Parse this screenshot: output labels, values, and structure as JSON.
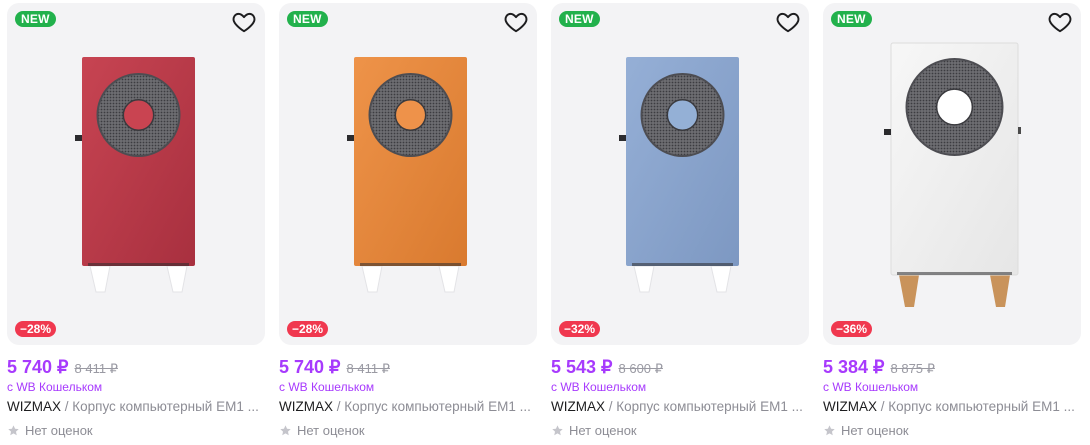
{
  "colors": {
    "accent": "#a73afd",
    "new_badge": "#22b14c",
    "discount_badge": "#f0384f"
  },
  "products": [
    {
      "badge_new": "NEW",
      "discount": "−28%",
      "price": "5 740 ₽",
      "old_price": "8 411 ₽",
      "wallet": "с WB Кошельком",
      "brand": "WIZMAX",
      "name": "Корпус компьютерный EM1 ...",
      "rating": "Нет оценок",
      "case_color": "#c74452",
      "case_shade": "#a8303f",
      "fan_center": "#c94451",
      "legs_color": "#ffffff"
    },
    {
      "badge_new": "NEW",
      "discount": "−28%",
      "price": "5 740 ₽",
      "old_price": "8 411 ₽",
      "wallet": "с WB Кошельком",
      "brand": "WIZMAX",
      "name": "Корпус компьютерный EM1 ...",
      "rating": "Нет оценок",
      "case_color": "#ee9349",
      "case_shade": "#d97a2f",
      "fan_center": "#ee924a",
      "legs_color": "#ffffff"
    },
    {
      "badge_new": "NEW",
      "discount": "−32%",
      "price": "5 543 ₽",
      "old_price": "8 600 ₽",
      "wallet": "с WB Кошельком",
      "brand": "WIZMAX",
      "name": "Корпус компьютерный EM1 ...",
      "rating": "Нет оценок",
      "case_color": "#95afd6",
      "case_shade": "#7d98c2",
      "fan_center": "#94b0d6",
      "legs_color": "#ffffff"
    },
    {
      "badge_new": "NEW",
      "discount": "−36%",
      "price": "5 384 ₽",
      "old_price": "8 875 ₽",
      "wallet": "с WB Кошельком",
      "brand": "WIZMAX",
      "name": "Корпус компьютерный EM1 ...",
      "rating": "Нет оценок",
      "case_color": "#f7f7f7",
      "case_shade": "#e6e6e6",
      "fan_center": "#ffffff",
      "legs_color": "#c9935b"
    }
  ]
}
